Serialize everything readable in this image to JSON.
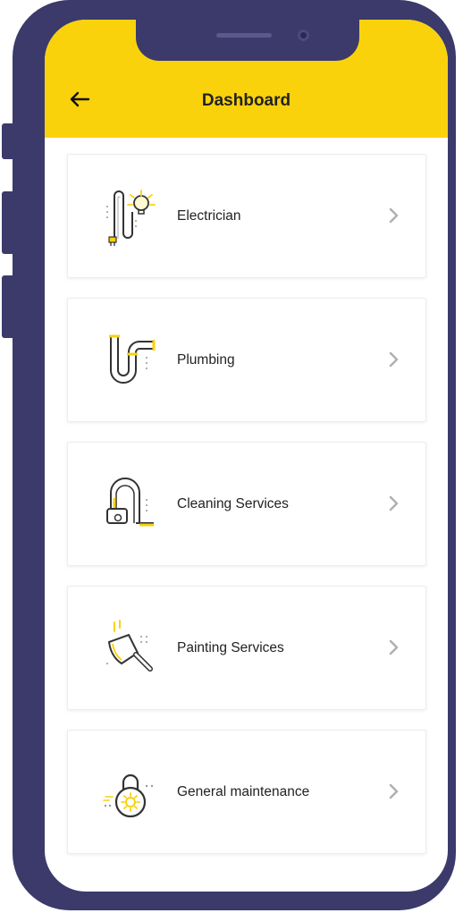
{
  "header": {
    "title": "Dashboard",
    "back_icon": "arrow-left-icon"
  },
  "colors": {
    "accent": "#fad20c",
    "frame": "#3b3a6b",
    "text": "#222222",
    "chevron": "#b0b0b0"
  },
  "services": [
    {
      "label": "Electrician",
      "icon": "electrician-icon"
    },
    {
      "label": "Plumbing",
      "icon": "plumbing-icon"
    },
    {
      "label": "Cleaning Services",
      "icon": "vacuum-icon"
    },
    {
      "label": "Painting Services",
      "icon": "paint-brush-icon"
    },
    {
      "label": "General maintenance",
      "icon": "maintenance-icon"
    }
  ]
}
